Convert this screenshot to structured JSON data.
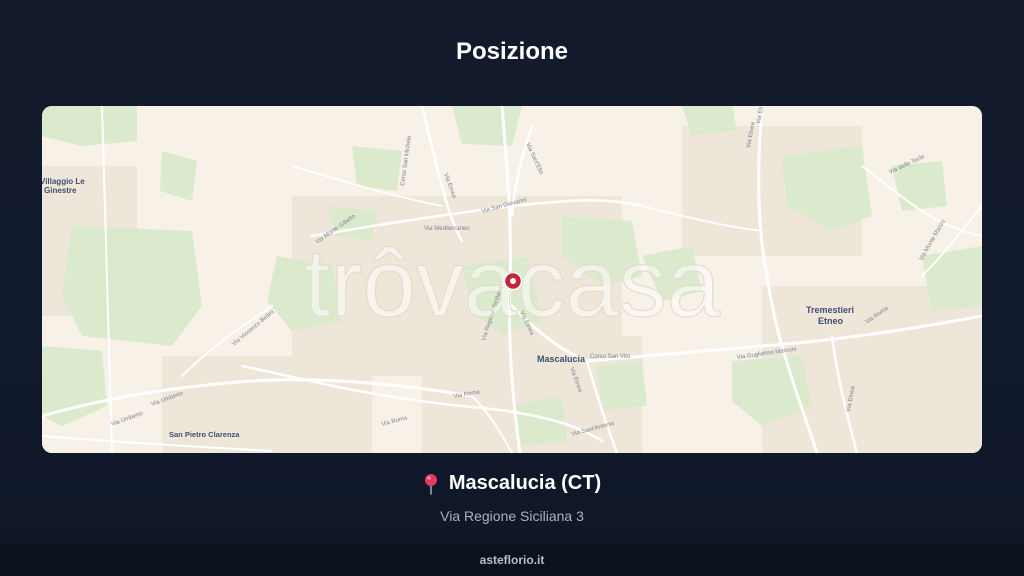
{
  "page": {
    "title": "Posizione"
  },
  "map": {
    "watermark": "trôvacasa",
    "places": {
      "villaggio_line1": "Villaggio Le",
      "villaggio_line2": "Ginestre",
      "mascalucia": "Mascalucia",
      "tremestieri_line1": "Tremestieri",
      "tremestieri_line2": "Etneo",
      "san_pietro": "San Pietro Clarenza"
    },
    "streets": {
      "via_etnea_top": "Via Etnea",
      "via_etnea_top2": "Via Etnea",
      "via_mediterraneo": "Via Mediterraneo",
      "via_san_giovanni": "Via San Giovanni",
      "via_santelia": "Via Sant'Elia",
      "corso_san_michele": "Corso San Michele",
      "via_monte_gibello": "Via Monte Gibello",
      "via_regione_siciliana": "Via Regione Siciliana",
      "via_etnea_center": "Via Etnea",
      "corso_san_vito": "Corso San Vito",
      "via_etnea_se": "Via Etnea",
      "via_guglielmo_marconi": "Via Guglielmo Marconi",
      "via_roma_right": "Via Roma",
      "via_etnea_right": "Via Etnea",
      "via_vincenzo_bellini": "Via Vincenzo Bellini",
      "via_roma_center": "Via Roma",
      "via_umberto": "Via Umberto",
      "via_umberto2": "Via Umberto",
      "via_sant_antonio": "Via Sant'Antonio",
      "via_delle_tecle": "Via delle Tecle",
      "via_monte_mazzo": "Via Monte Mazzo"
    },
    "colors": {
      "background": "#f7f1e8",
      "park": "#dceccf",
      "road": "#ffffff",
      "marker": "#c0273a"
    }
  },
  "location": {
    "pin_icon": "round-pushpin-icon",
    "city": "Mascalucia (CT)",
    "address": "Via Regione Siciliana 3"
  },
  "footer": {
    "site": "asteflorio.it"
  }
}
